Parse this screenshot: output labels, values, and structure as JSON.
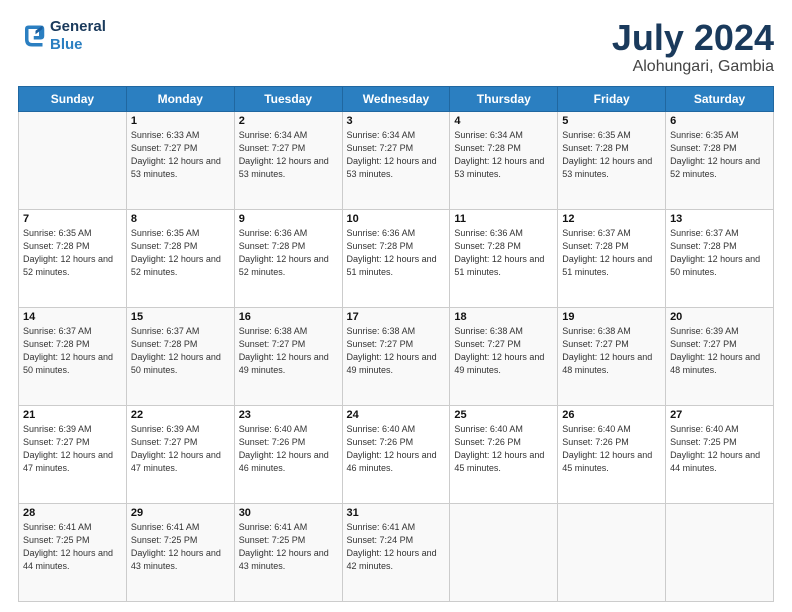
{
  "header": {
    "logo_line1": "General",
    "logo_line2": "Blue",
    "title": "July 2024",
    "subtitle": "Alohungari, Gambia"
  },
  "calendar": {
    "weekdays": [
      "Sunday",
      "Monday",
      "Tuesday",
      "Wednesday",
      "Thursday",
      "Friday",
      "Saturday"
    ],
    "weeks": [
      [
        {
          "day": "",
          "sunrise": "",
          "sunset": "",
          "daylight": ""
        },
        {
          "day": "1",
          "sunrise": "Sunrise: 6:33 AM",
          "sunset": "Sunset: 7:27 PM",
          "daylight": "Daylight: 12 hours and 53 minutes."
        },
        {
          "day": "2",
          "sunrise": "Sunrise: 6:34 AM",
          "sunset": "Sunset: 7:27 PM",
          "daylight": "Daylight: 12 hours and 53 minutes."
        },
        {
          "day": "3",
          "sunrise": "Sunrise: 6:34 AM",
          "sunset": "Sunset: 7:27 PM",
          "daylight": "Daylight: 12 hours and 53 minutes."
        },
        {
          "day": "4",
          "sunrise": "Sunrise: 6:34 AM",
          "sunset": "Sunset: 7:28 PM",
          "daylight": "Daylight: 12 hours and 53 minutes."
        },
        {
          "day": "5",
          "sunrise": "Sunrise: 6:35 AM",
          "sunset": "Sunset: 7:28 PM",
          "daylight": "Daylight: 12 hours and 53 minutes."
        },
        {
          "day": "6",
          "sunrise": "Sunrise: 6:35 AM",
          "sunset": "Sunset: 7:28 PM",
          "daylight": "Daylight: 12 hours and 52 minutes."
        }
      ],
      [
        {
          "day": "7",
          "sunrise": "Sunrise: 6:35 AM",
          "sunset": "Sunset: 7:28 PM",
          "daylight": "Daylight: 12 hours and 52 minutes."
        },
        {
          "day": "8",
          "sunrise": "Sunrise: 6:35 AM",
          "sunset": "Sunset: 7:28 PM",
          "daylight": "Daylight: 12 hours and 52 minutes."
        },
        {
          "day": "9",
          "sunrise": "Sunrise: 6:36 AM",
          "sunset": "Sunset: 7:28 PM",
          "daylight": "Daylight: 12 hours and 52 minutes."
        },
        {
          "day": "10",
          "sunrise": "Sunrise: 6:36 AM",
          "sunset": "Sunset: 7:28 PM",
          "daylight": "Daylight: 12 hours and 51 minutes."
        },
        {
          "day": "11",
          "sunrise": "Sunrise: 6:36 AM",
          "sunset": "Sunset: 7:28 PM",
          "daylight": "Daylight: 12 hours and 51 minutes."
        },
        {
          "day": "12",
          "sunrise": "Sunrise: 6:37 AM",
          "sunset": "Sunset: 7:28 PM",
          "daylight": "Daylight: 12 hours and 51 minutes."
        },
        {
          "day": "13",
          "sunrise": "Sunrise: 6:37 AM",
          "sunset": "Sunset: 7:28 PM",
          "daylight": "Daylight: 12 hours and 50 minutes."
        }
      ],
      [
        {
          "day": "14",
          "sunrise": "Sunrise: 6:37 AM",
          "sunset": "Sunset: 7:28 PM",
          "daylight": "Daylight: 12 hours and 50 minutes."
        },
        {
          "day": "15",
          "sunrise": "Sunrise: 6:37 AM",
          "sunset": "Sunset: 7:28 PM",
          "daylight": "Daylight: 12 hours and 50 minutes."
        },
        {
          "day": "16",
          "sunrise": "Sunrise: 6:38 AM",
          "sunset": "Sunset: 7:27 PM",
          "daylight": "Daylight: 12 hours and 49 minutes."
        },
        {
          "day": "17",
          "sunrise": "Sunrise: 6:38 AM",
          "sunset": "Sunset: 7:27 PM",
          "daylight": "Daylight: 12 hours and 49 minutes."
        },
        {
          "day": "18",
          "sunrise": "Sunrise: 6:38 AM",
          "sunset": "Sunset: 7:27 PM",
          "daylight": "Daylight: 12 hours and 49 minutes."
        },
        {
          "day": "19",
          "sunrise": "Sunrise: 6:38 AM",
          "sunset": "Sunset: 7:27 PM",
          "daylight": "Daylight: 12 hours and 48 minutes."
        },
        {
          "day": "20",
          "sunrise": "Sunrise: 6:39 AM",
          "sunset": "Sunset: 7:27 PM",
          "daylight": "Daylight: 12 hours and 48 minutes."
        }
      ],
      [
        {
          "day": "21",
          "sunrise": "Sunrise: 6:39 AM",
          "sunset": "Sunset: 7:27 PM",
          "daylight": "Daylight: 12 hours and 47 minutes."
        },
        {
          "day": "22",
          "sunrise": "Sunrise: 6:39 AM",
          "sunset": "Sunset: 7:27 PM",
          "daylight": "Daylight: 12 hours and 47 minutes."
        },
        {
          "day": "23",
          "sunrise": "Sunrise: 6:40 AM",
          "sunset": "Sunset: 7:26 PM",
          "daylight": "Daylight: 12 hours and 46 minutes."
        },
        {
          "day": "24",
          "sunrise": "Sunrise: 6:40 AM",
          "sunset": "Sunset: 7:26 PM",
          "daylight": "Daylight: 12 hours and 46 minutes."
        },
        {
          "day": "25",
          "sunrise": "Sunrise: 6:40 AM",
          "sunset": "Sunset: 7:26 PM",
          "daylight": "Daylight: 12 hours and 45 minutes."
        },
        {
          "day": "26",
          "sunrise": "Sunrise: 6:40 AM",
          "sunset": "Sunset: 7:26 PM",
          "daylight": "Daylight: 12 hours and 45 minutes."
        },
        {
          "day": "27",
          "sunrise": "Sunrise: 6:40 AM",
          "sunset": "Sunset: 7:25 PM",
          "daylight": "Daylight: 12 hours and 44 minutes."
        }
      ],
      [
        {
          "day": "28",
          "sunrise": "Sunrise: 6:41 AM",
          "sunset": "Sunset: 7:25 PM",
          "daylight": "Daylight: 12 hours and 44 minutes."
        },
        {
          "day": "29",
          "sunrise": "Sunrise: 6:41 AM",
          "sunset": "Sunset: 7:25 PM",
          "daylight": "Daylight: 12 hours and 43 minutes."
        },
        {
          "day": "30",
          "sunrise": "Sunrise: 6:41 AM",
          "sunset": "Sunset: 7:25 PM",
          "daylight": "Daylight: 12 hours and 43 minutes."
        },
        {
          "day": "31",
          "sunrise": "Sunrise: 6:41 AM",
          "sunset": "Sunset: 7:24 PM",
          "daylight": "Daylight: 12 hours and 42 minutes."
        },
        {
          "day": "",
          "sunrise": "",
          "sunset": "",
          "daylight": ""
        },
        {
          "day": "",
          "sunrise": "",
          "sunset": "",
          "daylight": ""
        },
        {
          "day": "",
          "sunrise": "",
          "sunset": "",
          "daylight": ""
        }
      ]
    ]
  }
}
